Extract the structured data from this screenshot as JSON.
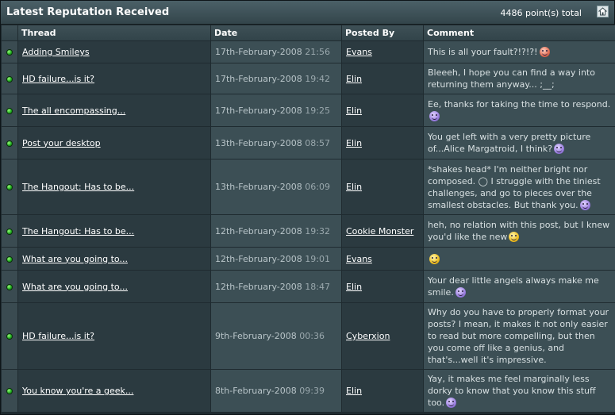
{
  "panel": {
    "title": "Latest Reputation Received",
    "total": "4486 point(s) total",
    "collapse_icon": "collapse-icon"
  },
  "columns": {
    "thread": "Thread",
    "date": "Date",
    "posted_by": "Posted By",
    "comment": "Comment"
  },
  "rows": [
    {
      "thread": "Adding Smileys",
      "date": "17th-February-2008",
      "time": "21:56",
      "user": "Evans",
      "comment": "This is all your fault?!?!?!",
      "smiley": "red"
    },
    {
      "thread": "HD failure...is it?",
      "date": "17th-February-2008",
      "time": "19:42",
      "user": "Elin",
      "comment": "Bleeeh, I hope you can find a way into returning them anyway... ;__;",
      "smiley": ""
    },
    {
      "thread": "The all encompassing...",
      "date": "17th-February-2008",
      "time": "19:25",
      "user": "Elin",
      "comment": "Ee, thanks for taking the time to respond.",
      "smiley": "purple"
    },
    {
      "thread": "Post your desktop",
      "date": "13th-February-2008",
      "time": "08:57",
      "user": "Elin",
      "comment": "You get left with a very pretty picture of...Alice Margatroid, I think?",
      "smiley": "purple"
    },
    {
      "thread": "The Hangout: Has to be...",
      "date": "13th-February-2008",
      "time": "06:09",
      "user": "Elin",
      "comment": "*shakes head* I'm neither bright nor composed. ◯ I struggle with the tiniest challenges, and go to pieces over the smallest obstacles. But thank you.",
      "smiley": "purple"
    },
    {
      "thread": "The Hangout: Has to be...",
      "date": "12th-February-2008",
      "time": "19:32",
      "user": "Cookie Monster",
      "comment": "heh, no relation with this post, but I knew you'd like the new",
      "smiley": "yellow"
    },
    {
      "thread": "What are you going to...",
      "date": "12th-February-2008",
      "time": "19:01",
      "user": "Evans",
      "comment": "",
      "smiley": "yellow"
    },
    {
      "thread": "What are you going to...",
      "date": "12th-February-2008",
      "time": "18:47",
      "user": "Elin",
      "comment": "Your dear little angels always make me smile.",
      "smiley": "purple"
    },
    {
      "thread": "HD failure...is it?",
      "date": "9th-February-2008",
      "time": "00:36",
      "user": "Cyberxion",
      "comment": "Why do you have to properly format your posts? I mean, it makes it not only easier to read but more compelling, but then you come off like a genius, and that's...well it's impressive.",
      "smiley": ""
    },
    {
      "thread": "You know you're a geek...",
      "date": "8th-February-2008",
      "time": "09:39",
      "user": "Elin",
      "comment": "Yay, it makes me feel marginally less dorky to know that you know this stuff too.",
      "smiley": "purple"
    }
  ]
}
